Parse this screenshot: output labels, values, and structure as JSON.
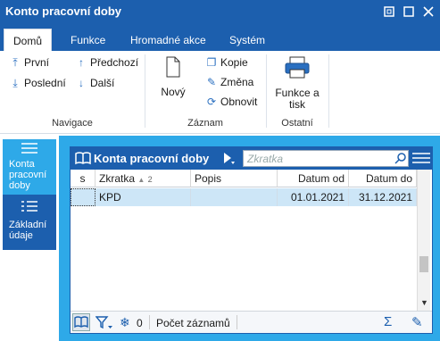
{
  "window": {
    "title": "Konto pracovní doby"
  },
  "ribbon_tabs": [
    "Domů",
    "Funkce",
    "Hromadné akce",
    "Systém"
  ],
  "ribbon": {
    "navigace": {
      "label": "Navigace",
      "prvni": "První",
      "predchozi": "Předchozí",
      "posledni": "Poslední",
      "dalsi": "Další"
    },
    "zaznam": {
      "label": "Záznam",
      "novy": "Nový",
      "kopie": "Kopie",
      "zmena": "Změna",
      "obnovit": "Obnovit"
    },
    "ostatni": {
      "label": "Ostatní",
      "funkce_tisk_1": "Funkce a",
      "funkce_tisk_2": "tisk"
    }
  },
  "sidebar": {
    "items": [
      {
        "line1": "Konta",
        "line2": "pracovní",
        "line3": "doby"
      },
      {
        "line1": "Základní",
        "line2": "údaje"
      }
    ]
  },
  "panel": {
    "title": "Konta pracovní doby",
    "search_placeholder": "Zkratka",
    "columns": [
      "s",
      "Zkratka",
      "2",
      "Popis",
      "Datum od",
      "Datum do"
    ],
    "rows": [
      {
        "s": "",
        "zkratka": "KPD",
        "popis": "",
        "datum_od": "01.01.2021",
        "datum_do": "31.12.2021"
      }
    ],
    "footer": {
      "filter_count": "0",
      "record_count_label": "Počet záznamů"
    }
  },
  "colors": {
    "brand": "#1c5fae",
    "accent": "#2ea9e8",
    "selected_row": "#cde6f7"
  }
}
